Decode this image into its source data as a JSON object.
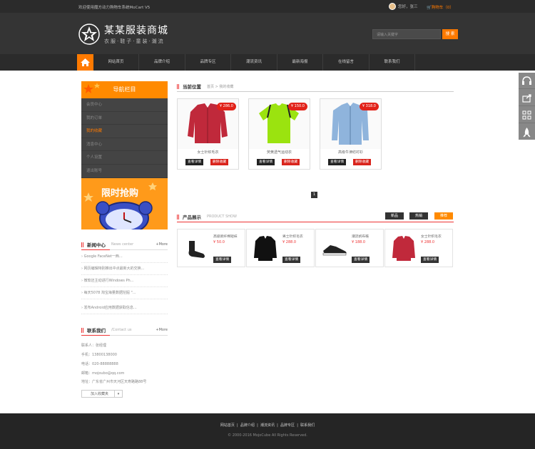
{
  "topbar": {
    "welcome": "欢迎使用魔方动力购物车系统MoCart V5",
    "user": "您好，张三",
    "cart": "购物车（0）"
  },
  "header": {
    "logo_title": "某某服装商城",
    "logo_sub": "衣服·鞋子·童装·潮流",
    "search_placeholder": "请输入关键字",
    "search_btn": "搜 索"
  },
  "nav": {
    "items": [
      "网站首页",
      "品牌介绍",
      "品牌专区",
      "潮流资讯",
      "最新海报",
      "在线留言",
      "联系我们"
    ]
  },
  "sidebar": {
    "title": "导航栏目",
    "items": [
      "会员中心",
      "我的订单",
      "我的收藏",
      "消息中心",
      "个人设置",
      "退出账号"
    ],
    "active_index": 2,
    "promo": "限时抢购"
  },
  "news": {
    "title": "新闻中心",
    "sub": "News center",
    "more": "+More",
    "items": [
      "Google FaceNet一西...",
      "网页编辑特别推出中点最新大的交换...",
      "微软还主动进行Windows Ph...",
      "每天5078 淘宝海量数据挖掘 \"...",
      "发布Android应用数据获取信息..."
    ]
  },
  "contact": {
    "title": "联系我们",
    "sub": "/Contact us",
    "more": "+More",
    "lines": [
      "联系人：张经理",
      "手机：13800138000",
      "电话：020-88888888",
      "邮箱：mojoubo@qq.com",
      "地址：广东省广州市天河区天寿路路88号"
    ],
    "fav": "加入收藏夹"
  },
  "crumb": {
    "title": "当前位置",
    "path": "首页 > 我的收藏"
  },
  "favorites": [
    {
      "price": "¥ 286.0",
      "name": "女士针织毛衣",
      "btn1": "查看详情",
      "btn2": "删除收藏",
      "color": "#c0293b"
    },
    {
      "price": "¥ 150.0",
      "name": "荧黄透气运动衣",
      "btn1": "查看详情",
      "btn2": "删除收藏",
      "color": "#9be30f"
    },
    {
      "price": "¥ 318.0",
      "name": "高级牛津纺衬衫",
      "btn1": "查看详情",
      "btn2": "删除收藏",
      "color": "#8fb4dc"
    }
  ],
  "pager": "1",
  "products": {
    "title": "产品展示",
    "sub": "PRODUCT SHOW",
    "tabs": [
      "新品",
      "热销",
      "推荐"
    ],
    "active_tab": 2,
    "items": [
      {
        "name": "高级新纤棉短袜",
        "price": "¥ 50.0",
        "btn": "查看详情",
        "icon": "sock-icon"
      },
      {
        "name": "男士针织毛衣",
        "price": "¥ 288.0",
        "btn": "查看详情",
        "icon": "cardigan-icon"
      },
      {
        "name": "潮流帆布鞋",
        "price": "¥ 188.0",
        "btn": "查看详情",
        "icon": "sneaker-icon"
      },
      {
        "name": "女士针织毛衣",
        "price": "¥ 288.0",
        "btn": "查看详情",
        "icon": "cardigan-icon"
      }
    ]
  },
  "footer": {
    "links": [
      "网站首页",
      "品牌介绍",
      "潮流资讯",
      "品牌专区",
      "联系我们"
    ],
    "copyright": "© 2000-2016 MojoCube All Rights Reserved."
  },
  "colors": {
    "accent": "#ff8a00",
    "red": "#e2231a",
    "dark": "#2b2b2b"
  }
}
